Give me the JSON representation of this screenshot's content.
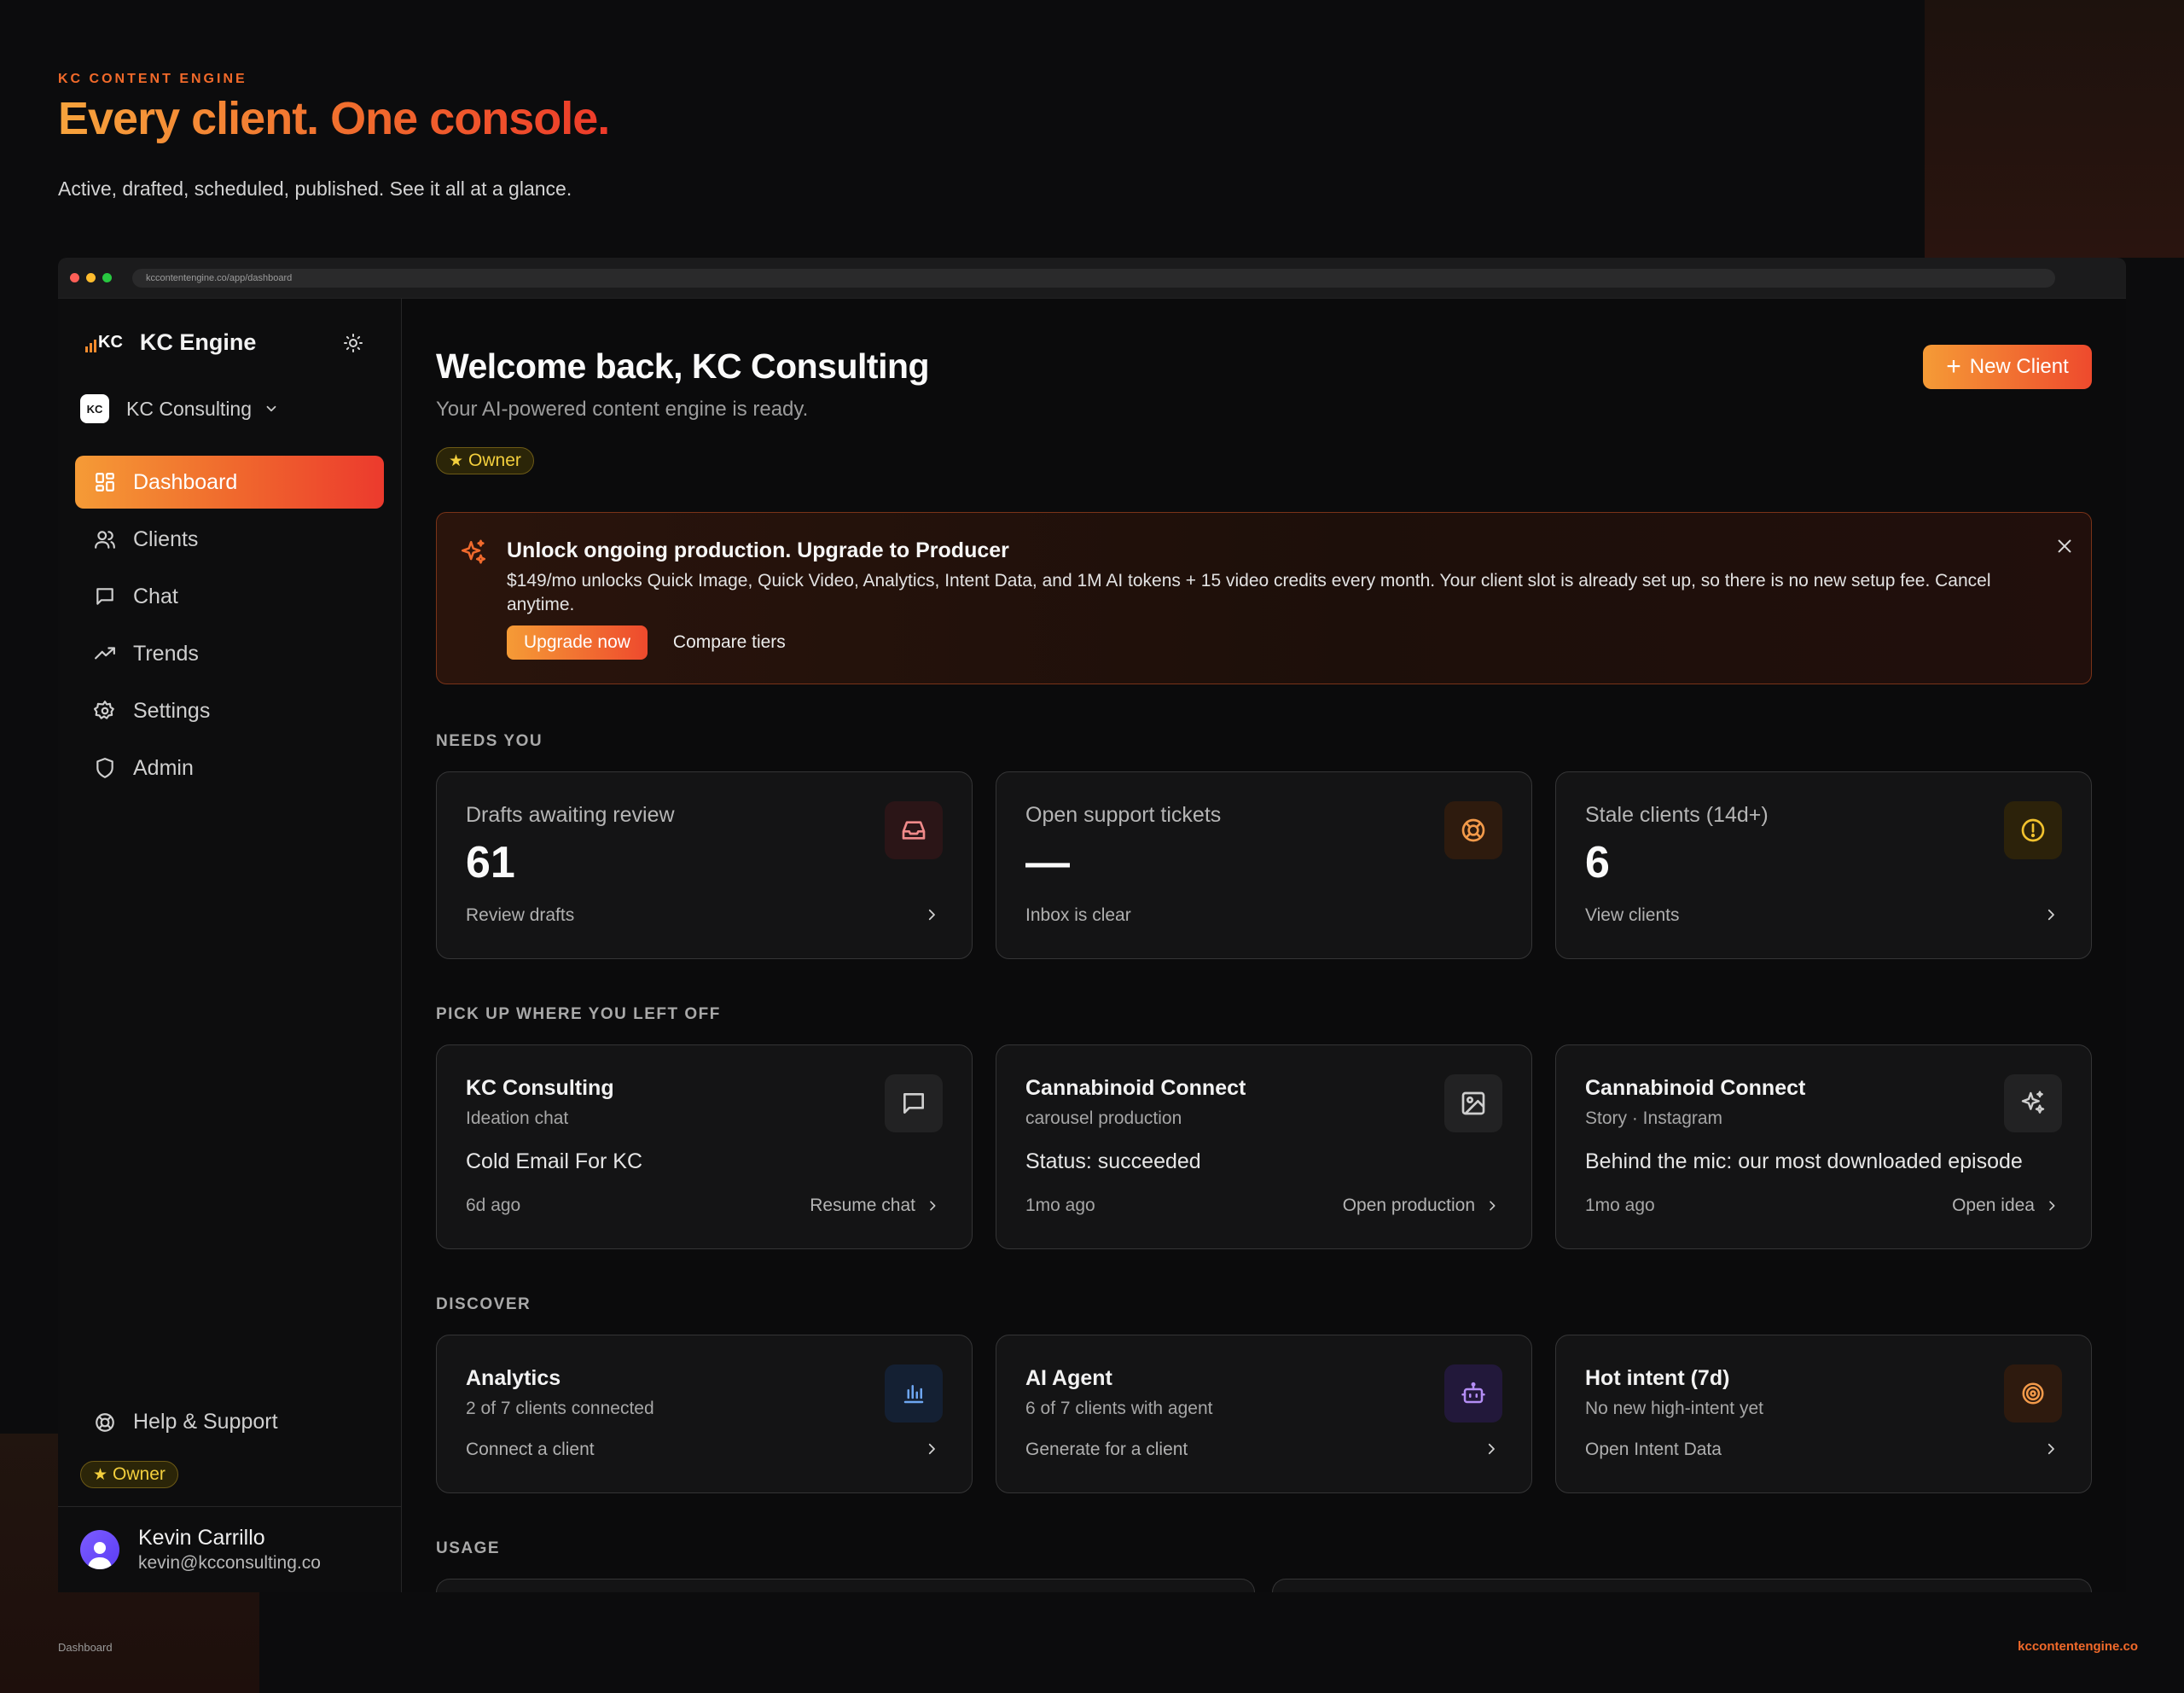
{
  "hero": {
    "kicker": "KC CONTENT ENGINE",
    "title": "Every client. One console.",
    "subtitle": "Active, drafted, scheduled, published. See it all at a glance."
  },
  "browser": {
    "url": "kccontentengine.co/app/dashboard"
  },
  "sidebar": {
    "logo_text": "KC",
    "brand": "KC Engine",
    "workspace": {
      "avatar": "KC",
      "name": "KC Consulting"
    },
    "nav": [
      {
        "label": "Dashboard",
        "icon": "dashboard-icon",
        "active": true
      },
      {
        "label": "Clients",
        "icon": "users-icon"
      },
      {
        "label": "Chat",
        "icon": "chat-icon"
      },
      {
        "label": "Trends",
        "icon": "trend-icon"
      },
      {
        "label": "Settings",
        "icon": "gear-icon"
      },
      {
        "label": "Admin",
        "icon": "shield-icon"
      }
    ],
    "help": "Help & Support",
    "role": "Owner",
    "user": {
      "name": "Kevin Carrillo",
      "email": "kevin@kcconsulting.co"
    }
  },
  "main": {
    "welcome": "Welcome back, KC Consulting",
    "subtitle": "Your AI-powered content engine is ready.",
    "role": "Owner",
    "new_client": "New Client",
    "banner": {
      "title": "Unlock ongoing production. Upgrade to Producer",
      "text": "$149/mo unlocks Quick Image, Quick Video, Analytics, Intent Data, and 1M AI tokens + 15 video credits every month. Your client slot is already set up, so there is no new setup fee. Cancel anytime.",
      "primary": "Upgrade now",
      "secondary": "Compare tiers"
    },
    "needs_you": {
      "label": "NEEDS YOU",
      "cards": [
        {
          "label": "Drafts awaiting review",
          "value": "61",
          "link": "Review drafts",
          "icon": "inbox-icon",
          "has_chevron": true
        },
        {
          "label": "Open support tickets",
          "value": "—",
          "link": "Inbox is clear",
          "icon": "lifebuoy-icon",
          "has_chevron": false
        },
        {
          "label": "Stale clients (14d+)",
          "value": "6",
          "link": "View clients",
          "icon": "alert-circle-icon",
          "has_chevron": true
        }
      ]
    },
    "recent": {
      "label": "PICK UP WHERE YOU LEFT OFF",
      "cards": [
        {
          "title": "KC Consulting",
          "sub": "Ideation chat",
          "body": "Cold Email For KC",
          "time": "6d ago",
          "action": "Resume chat",
          "icon": "chat-icon"
        },
        {
          "title": "Cannabinoid Connect",
          "sub": "carousel production",
          "body": "Status: succeeded",
          "time": "1mo ago",
          "action": "Open production",
          "icon": "image-icon"
        },
        {
          "title": "Cannabinoid Connect",
          "sub": "Story · Instagram",
          "body": "Behind the mic: our most downloaded episode",
          "time": "1mo ago",
          "action": "Open idea",
          "icon": "sparkles-icon"
        }
      ]
    },
    "discover": {
      "label": "DISCOVER",
      "cards": [
        {
          "title": "Analytics",
          "sub": "2 of 7 clients connected",
          "link": "Connect a client",
          "icon": "bar-chart-icon"
        },
        {
          "title": "AI Agent",
          "sub": "6 of 7 clients with agent",
          "link": "Generate for a client",
          "icon": "robot-icon"
        },
        {
          "title": "Hot intent (7d)",
          "sub": "No new high-intent yet",
          "link": "Open Intent Data",
          "icon": "target-icon"
        }
      ]
    },
    "usage": {
      "label": "USAGE"
    }
  },
  "footer": {
    "left": "Dashboard",
    "right": "kccontentengine.co"
  },
  "colors": {
    "accent": "#f06a2d",
    "accent_start": "#f59b36",
    "accent_end": "#ec3a2d",
    "owner_gold": "#f3cf3d"
  }
}
